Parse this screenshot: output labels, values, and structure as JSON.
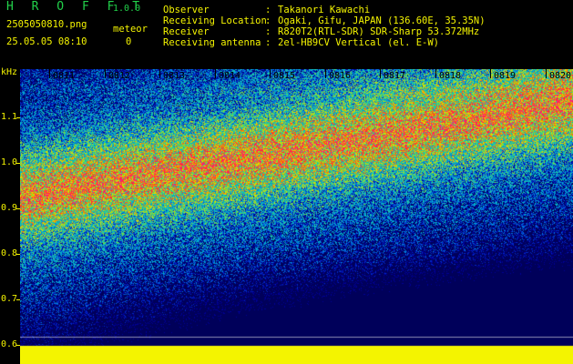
{
  "header": {
    "app_title": "H R O F F T",
    "app_version": "1.0.0",
    "filename": "2505050810.png",
    "timestamp": "25.05.05 08:10",
    "meteor_label": "meteor",
    "meteor_count": "0",
    "info": [
      {
        "label": "Observer",
        "sep": ":",
        "value": "Takanori Kawachi"
      },
      {
        "label": "Receiving Location",
        "sep": ":",
        "value": "Ogaki, Gifu, JAPAN (136.60E, 35.35N)"
      },
      {
        "label": "Receiver",
        "sep": ":",
        "value": "R820T2(RTL-SDR) SDR-Sharp 53.372MHz"
      },
      {
        "label": "Receiving antenna",
        "sep": ":",
        "value": "2el-HB9CV Vertical (el. E-W)"
      }
    ]
  },
  "y_axis": {
    "unit": "kHz",
    "ticks": [
      "1.1",
      "1.0",
      "0.9",
      "0.8",
      "0.7",
      "0.6"
    ]
  },
  "x_axis": {
    "ticks": [
      "0811",
      "0812",
      "0813",
      "0814",
      "0815",
      "0816",
      "0817",
      "0818",
      "0819",
      "0820"
    ]
  },
  "colors": {
    "label_yellow": "#f4f400",
    "title_green": "#22d14a",
    "noise_floor_band": "#f4f400"
  }
}
